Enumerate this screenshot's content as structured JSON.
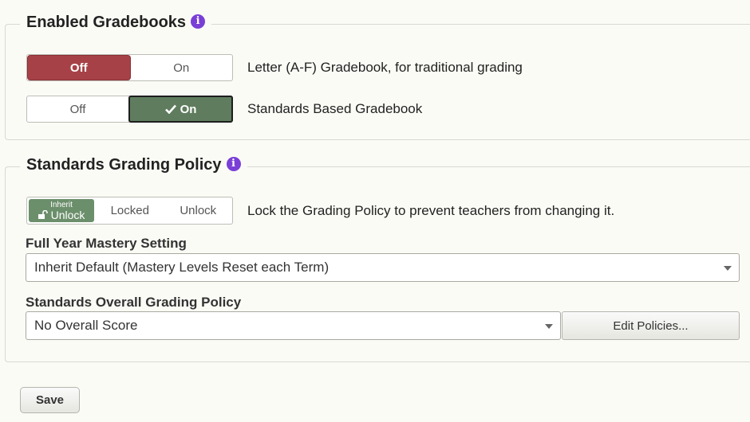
{
  "enabled_gradebooks": {
    "title": "Enabled Gradebooks",
    "letter": {
      "off_label": "Off",
      "on_label": "On",
      "selected": "Off",
      "description": "Letter (A-F) Gradebook, for traditional grading"
    },
    "standards": {
      "off_label": "Off",
      "on_label": "On",
      "selected": "On",
      "description": "Standards Based Gradebook"
    }
  },
  "standards_policy": {
    "title": "Standards Grading Policy",
    "lock_toggle": {
      "inherit_small": "Inherit",
      "inherit_label": "Unlock",
      "locked_label": "Locked",
      "unlock_label": "Unlock",
      "selected": "Inherit",
      "description": "Lock the Grading Policy to prevent teachers from changing it."
    },
    "full_year": {
      "label": "Full Year Mastery Setting",
      "value": "Inherit Default (Mastery Levels Reset each Term)"
    },
    "overall": {
      "label": "Standards Overall Grading Policy",
      "value": "No Overall Score",
      "edit_button": "Edit Policies..."
    }
  },
  "save_label": "Save",
  "colors": {
    "off_active": "#a64247",
    "on_active": "#5f7d5e",
    "inherit_active": "#6c8f6b",
    "info_icon": "#7a3fd6"
  },
  "icons": [
    "info-icon",
    "check-icon",
    "unlock-icon",
    "caret-down-icon"
  ]
}
